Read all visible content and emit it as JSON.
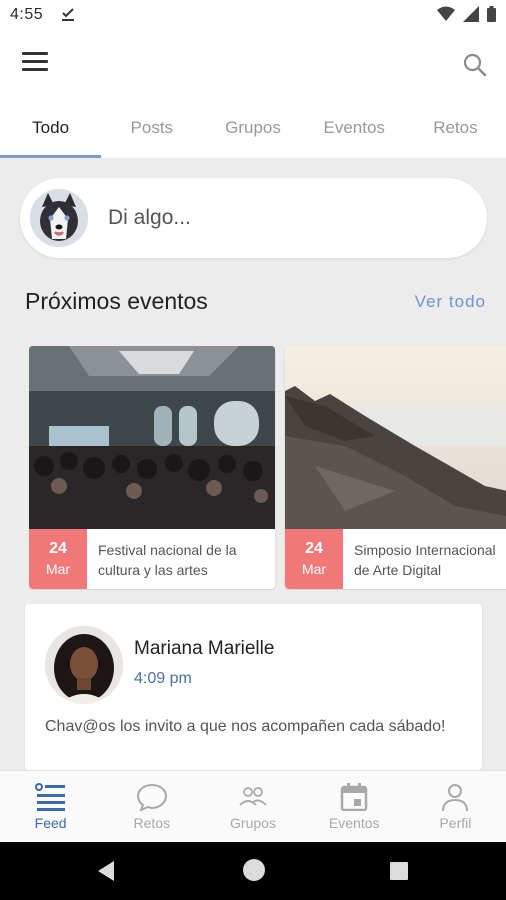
{
  "status_bar": {
    "time": "4:55"
  },
  "header": {
    "menu_icon": "hamburger-icon",
    "search_icon": "search-icon"
  },
  "tabs": [
    {
      "label": "Todo",
      "active": true
    },
    {
      "label": "Posts",
      "active": false
    },
    {
      "label": "Grupos",
      "active": false
    },
    {
      "label": "Eventos",
      "active": false
    },
    {
      "label": "Retos",
      "active": false
    }
  ],
  "composer": {
    "placeholder": "Di algo..."
  },
  "events_section": {
    "title": "Próximos eventos",
    "see_all": "Ver todo",
    "events": [
      {
        "day": "24",
        "month": "Mar",
        "title_line1": "Festival nacional de la",
        "title_line2": "cultura y las artes"
      },
      {
        "day": "24",
        "month": "Mar",
        "title_line1": "Simposio Internacional",
        "title_line2": "de Arte Digital"
      }
    ]
  },
  "post": {
    "author": "Mariana Marielle",
    "time": "4:09 pm",
    "text": "Chav@os los invito a que nos acompañen cada sábado!"
  },
  "bottom_nav": [
    {
      "label": "Feed",
      "icon": "feed-icon",
      "active": true
    },
    {
      "label": "Retos",
      "icon": "chat-bubble-icon",
      "active": false
    },
    {
      "label": "Grupos",
      "icon": "group-icon",
      "active": false
    },
    {
      "label": "Eventos",
      "icon": "calendar-icon",
      "active": false
    },
    {
      "label": "Perfil",
      "icon": "person-icon",
      "active": false
    }
  ],
  "colors": {
    "accent": "#6e93d6",
    "active_nav": "#3c6ab0",
    "date_badge": "#f07878",
    "background": "#ececec"
  }
}
